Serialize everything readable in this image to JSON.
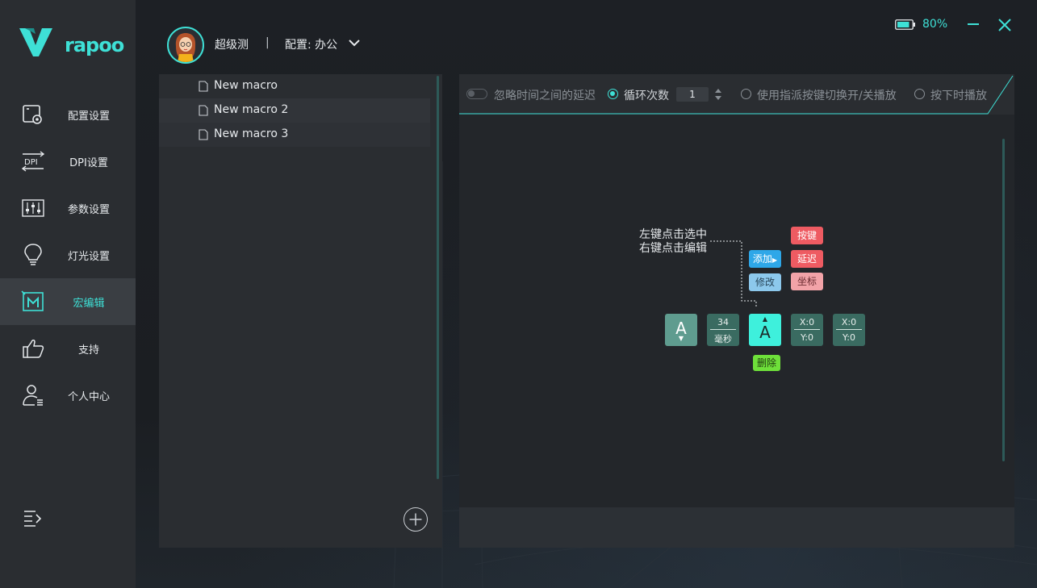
{
  "app": {
    "brand": "rapoo"
  },
  "header": {
    "username": "超级测",
    "separator": "|",
    "profile_label": "配置: 办公",
    "battery_pct": "80%"
  },
  "sidebar": {
    "items": [
      {
        "label": "配置设置",
        "icon": "config-icon"
      },
      {
        "label": "DPI设置",
        "icon": "dpi-icon"
      },
      {
        "label": "参数设置",
        "icon": "sliders-icon"
      },
      {
        "label": "灯光设置",
        "icon": "lightbulb-icon"
      },
      {
        "label": "宏编辑",
        "icon": "macro-icon",
        "active": true
      },
      {
        "label": "支持",
        "icon": "thumbs-up-icon"
      },
      {
        "label": "个人中心",
        "icon": "user-icon"
      }
    ]
  },
  "macros": {
    "items": [
      "New macro",
      "New macro 2",
      "New macro 3"
    ]
  },
  "toolbar": {
    "ignore_delay": "忽略时间之间的延迟",
    "loop_count_label": "循环次数",
    "loop_count_value": "1",
    "toggle_play": "使用指派按键切换开/关播放",
    "hold_play": "按下时播放"
  },
  "guide": {
    "hint_line1": "左键点击选中",
    "hint_line2": "右键点击编辑",
    "add_label": "添加",
    "modify_label": "修改",
    "key_label": "按键",
    "delay_label": "延迟",
    "coord_label": "坐标",
    "delete_label": "删除",
    "key_a": "A",
    "key_a_selected": "A",
    "delay_value": "34",
    "delay_unit": "毫秒",
    "coord1_x": "X:0",
    "coord1_y": "Y:0",
    "coord2_x": "X:0",
    "coord2_y": "Y:0"
  },
  "colors": {
    "accent": "#3ee0d6",
    "add": "#2ea7e8",
    "key": "#ee5b62",
    "delete": "#6ee03a"
  }
}
